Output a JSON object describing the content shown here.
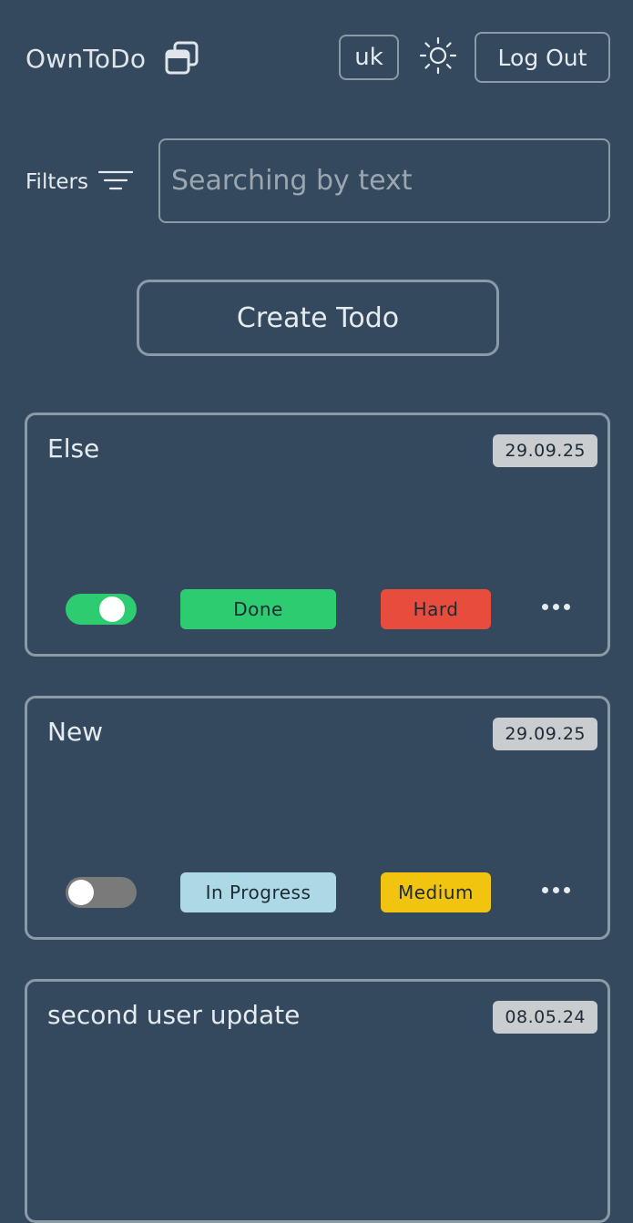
{
  "header": {
    "brand": "OwnToDo",
    "lang_label": "uk",
    "logout_label": "Log Out"
  },
  "filters": {
    "label": "Filters",
    "search_placeholder": "Searching by text"
  },
  "create_label": "Create Todo",
  "colors": {
    "background": "#34495e",
    "border": "#8a9ba5",
    "done": "#2ecc71",
    "in_progress": "#add8e6",
    "hard": "#e74c3c",
    "medium": "#f1c40f",
    "date_badge": "#c9cdd0"
  },
  "todos": [
    {
      "title": "Else",
      "date": "29.09.25",
      "completed": true,
      "status": "Done",
      "priority": "Hard"
    },
    {
      "title": "New",
      "date": "29.09.25",
      "completed": false,
      "status": "In Progress",
      "priority": "Medium"
    },
    {
      "title": "second user update",
      "date": "08.05.24"
    }
  ]
}
